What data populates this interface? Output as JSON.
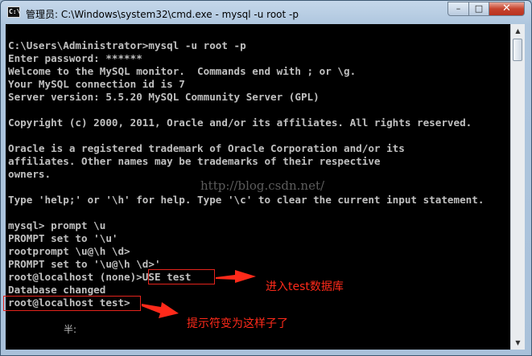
{
  "window": {
    "title": "管理员: C:\\Windows\\system32\\cmd.exe - mysql  -u root -p",
    "icon_label": "C:\\",
    "controls": {
      "minimize": "–",
      "maximize": "□",
      "close": "✕"
    }
  },
  "terminal": {
    "lines": [
      "C:\\Users\\Administrator>mysql -u root -p",
      "Enter password: ******",
      "Welcome to the MySQL monitor.  Commands end with ; or \\g.",
      "Your MySQL connection id is 7",
      "Server version: 5.5.20 MySQL Community Server (GPL)",
      "",
      "Copyright (c) 2000, 2011, Oracle and/or its affiliates. All rights reserved.",
      "",
      "Oracle is a registered trademark of Oracle Corporation and/or its",
      "affiliates. Other names may be trademarks of their respective",
      "owners.",
      "",
      "Type 'help;' or '\\h' for help. Type '\\c' to clear the current input statement.",
      "",
      "mysql> prompt \\u",
      "PROMPT set to '\\u'",
      "rootprompt \\u@\\h \\d>",
      "PROMPT set to '\\u@\\h \\d>'",
      "root@localhost (none)>USE test",
      "Database changed",
      "root@localhost test>"
    ],
    "ime_fragment": "半:"
  },
  "watermark": "http://blog.csdn.net/",
  "annotations": {
    "use_test_note": "进入test数据库",
    "prompt_note": "提示符变为这样子了"
  },
  "colors": {
    "terminal_bg": "#000000",
    "terminal_fg": "#c0c0c0",
    "annotation": "#ff2a1a",
    "titlebar": "#b9cfe6"
  },
  "scrollbar": {
    "up_icon": "▲",
    "down_icon": "▼"
  }
}
